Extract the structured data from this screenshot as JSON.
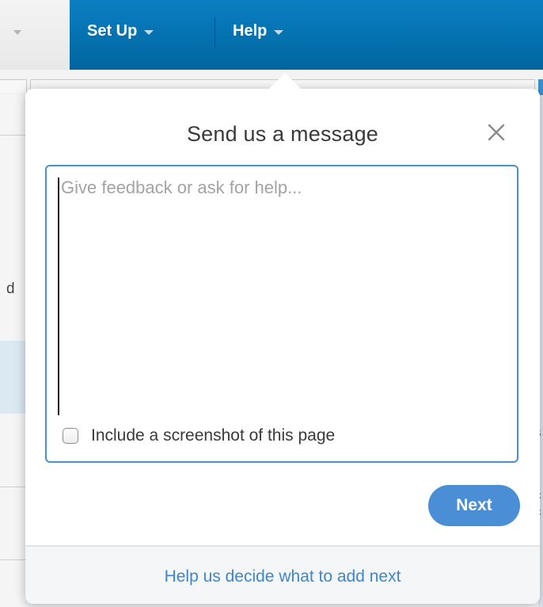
{
  "nav": {
    "items": [
      {
        "label": "Set Up"
      },
      {
        "label": "Help"
      }
    ]
  },
  "background": {
    "left_glyph": "d",
    "right_glyphs": [
      "s",
      "c",
      "c",
      "t"
    ]
  },
  "dialog": {
    "title": "Send us a message",
    "message_placeholder": "Give feedback or ask for help...",
    "message_value": "",
    "screenshot_checkbox_label": "Include a screenshot of this page",
    "screenshot_checked": false,
    "next_label": "Next",
    "footer_link": "Help us decide what to add next"
  },
  "colors": {
    "nav_blue": "#0a7fc2",
    "accent": "#4a8fd6",
    "link": "#3d87c9"
  },
  "icons": {
    "close": "close-icon",
    "caret": "caret-down-icon"
  }
}
